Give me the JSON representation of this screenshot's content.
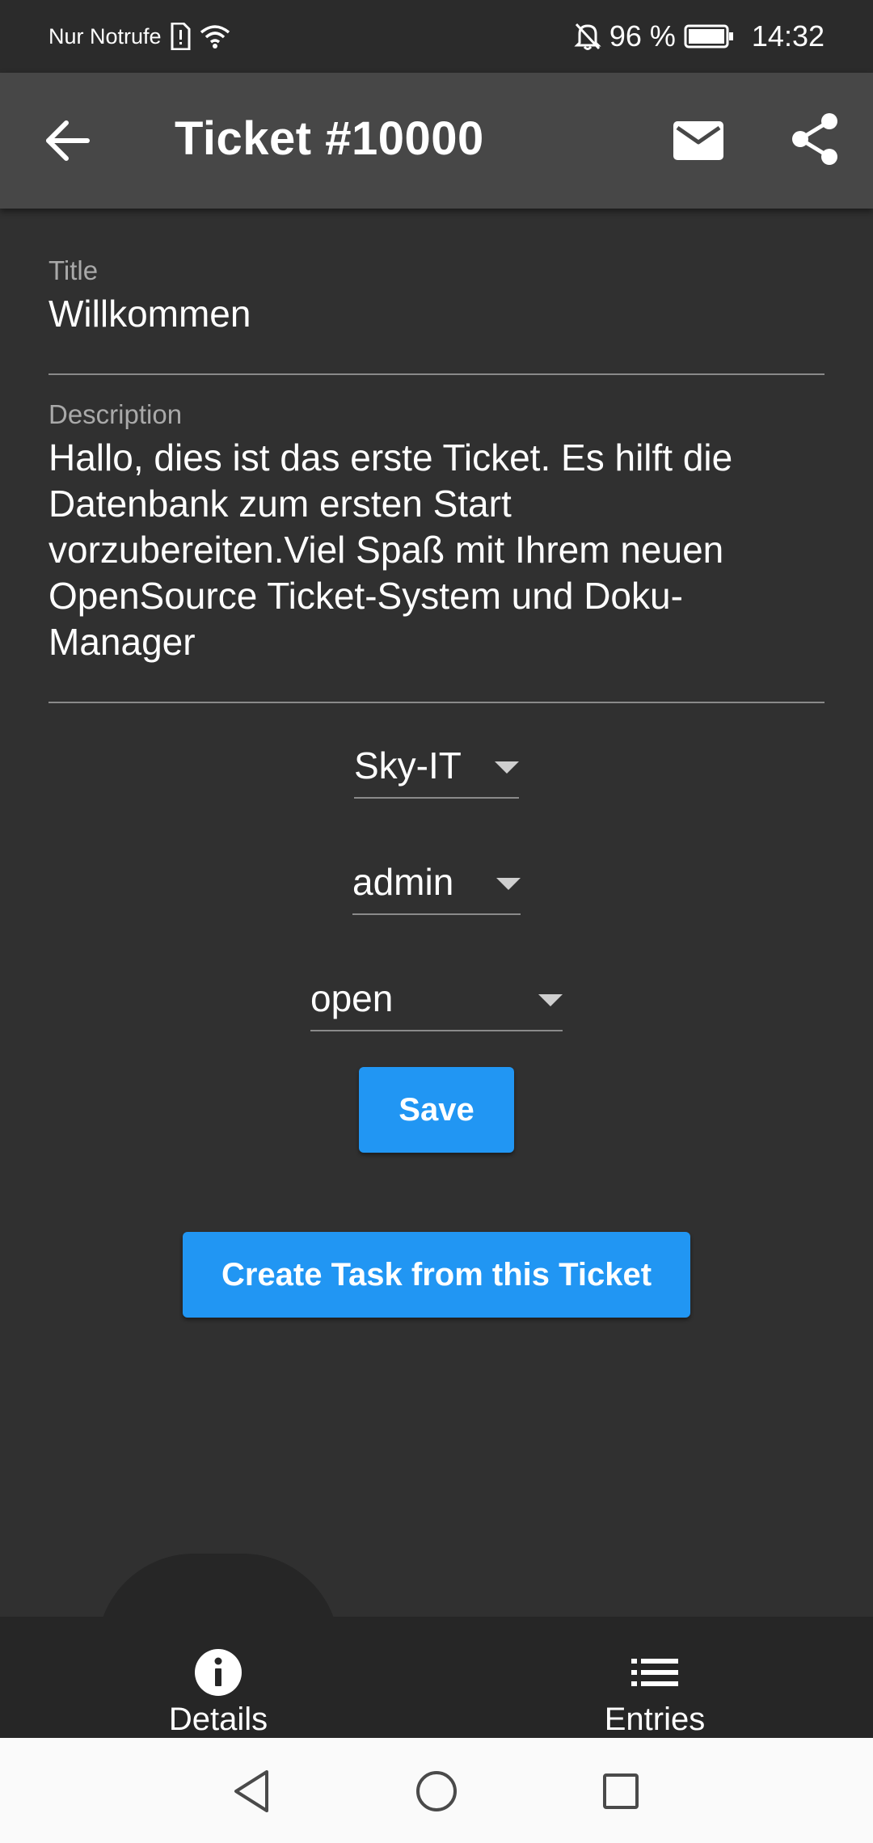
{
  "status_bar": {
    "carrier": "Nur Notrufe",
    "battery_percent": "96 %",
    "time": "14:32"
  },
  "app_bar": {
    "title": "Ticket #10000",
    "icons": [
      "arrow-back-icon",
      "mail-icon",
      "share-icon"
    ]
  },
  "form": {
    "title_label": "Title",
    "title_value": "Willkommen",
    "description_label": "Description",
    "description_lines": [
      "Hallo, dies ist das erste Ticket. Es hilft die",
      "Datenbank zum ersten Start",
      "vorzubereiten.Viel Spaß mit Ihrem neuen",
      "OpenSource Ticket-System und Doku-",
      "Manager"
    ],
    "company_selected": "Sky-IT",
    "user_selected": "admin",
    "status_selected": "open",
    "save_label": "Save",
    "create_task_label": "Create Task from this Ticket"
  },
  "bottom_nav": {
    "details_label": "Details",
    "entries_label": "Entries",
    "active_tab": "Details"
  },
  "colors": {
    "background": "#303030",
    "app_bar": "#474747",
    "accent": "#2196f3",
    "bottom_nav": "#262626"
  }
}
